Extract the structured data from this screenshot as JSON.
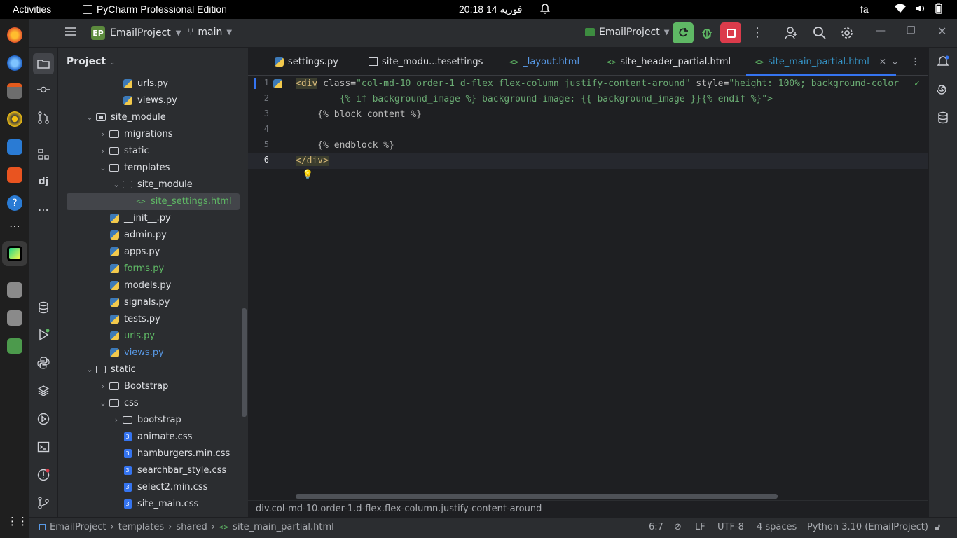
{
  "os_bar": {
    "activities": "Activities",
    "app_name": "PyCharm Professional Edition",
    "clock": "20:18  فوریه 14",
    "lang": "fa"
  },
  "toolbar": {
    "project_badge": "EP",
    "project_name": "EmailProject",
    "branch": "main",
    "run_config": "EmailProject"
  },
  "project_panel": {
    "title": "Project"
  },
  "tree": [
    {
      "label": "urls.py",
      "indent": 4,
      "type": "py",
      "chev": "",
      "color": "#dfe1e5"
    },
    {
      "label": "views.py",
      "indent": 4,
      "type": "py",
      "chev": "",
      "color": "#dfe1e5"
    },
    {
      "label": "site_module",
      "indent": 2,
      "type": "module",
      "chev": "⌄",
      "color": "#dfe1e5"
    },
    {
      "label": "migrations",
      "indent": 3,
      "type": "folder",
      "chev": "›",
      "color": "#dfe1e5"
    },
    {
      "label": "static",
      "indent": 3,
      "type": "folder",
      "chev": "›",
      "color": "#dfe1e5"
    },
    {
      "label": "templates",
      "indent": 3,
      "type": "folder",
      "chev": "⌄",
      "color": "#dfe1e5"
    },
    {
      "label": "site_module",
      "indent": 4,
      "type": "folder",
      "chev": "⌄",
      "color": "#dfe1e5"
    },
    {
      "label": "site_settings.html",
      "indent": 5,
      "type": "html",
      "chev": "",
      "color": "#5fb865"
    },
    {
      "label": "__init__.py",
      "indent": 3,
      "type": "py",
      "chev": "",
      "color": "#dfe1e5"
    },
    {
      "label": "admin.py",
      "indent": 3,
      "type": "py",
      "chev": "",
      "color": "#dfe1e5"
    },
    {
      "label": "apps.py",
      "indent": 3,
      "type": "py",
      "chev": "",
      "color": "#dfe1e5"
    },
    {
      "label": "forms.py",
      "indent": 3,
      "type": "py",
      "chev": "",
      "color": "#5fb865"
    },
    {
      "label": "models.py",
      "indent": 3,
      "type": "py",
      "chev": "",
      "color": "#dfe1e5"
    },
    {
      "label": "signals.py",
      "indent": 3,
      "type": "py",
      "chev": "",
      "color": "#dfe1e5"
    },
    {
      "label": "tests.py",
      "indent": 3,
      "type": "py",
      "chev": "",
      "color": "#dfe1e5"
    },
    {
      "label": "urls.py",
      "indent": 3,
      "type": "py",
      "chev": "",
      "color": "#5fb865"
    },
    {
      "label": "views.py",
      "indent": 3,
      "type": "py",
      "chev": "",
      "color": "#5899e6"
    },
    {
      "label": "static",
      "indent": 2,
      "type": "folder",
      "chev": "⌄",
      "color": "#dfe1e5"
    },
    {
      "label": "Bootstrap",
      "indent": 3,
      "type": "folder",
      "chev": "›",
      "color": "#dfe1e5"
    },
    {
      "label": "css",
      "indent": 3,
      "type": "folder",
      "chev": "⌄",
      "color": "#dfe1e5"
    },
    {
      "label": "bootstrap",
      "indent": 4,
      "type": "folder",
      "chev": "›",
      "color": "#dfe1e5"
    },
    {
      "label": "animate.css",
      "indent": 4,
      "type": "css",
      "chev": "",
      "color": "#dfe1e5"
    },
    {
      "label": "hamburgers.min.css",
      "indent": 4,
      "type": "css",
      "chev": "",
      "color": "#dfe1e5"
    },
    {
      "label": "searchbar_style.css",
      "indent": 4,
      "type": "css",
      "chev": "",
      "color": "#dfe1e5"
    },
    {
      "label": "select2.min.css",
      "indent": 4,
      "type": "css",
      "chev": "",
      "color": "#dfe1e5"
    },
    {
      "label": "site_main.css",
      "indent": 4,
      "type": "css",
      "chev": "",
      "color": "#dfe1e5"
    }
  ],
  "tabs": [
    {
      "label": "settings.py",
      "icon": "py"
    },
    {
      "label": "site_modu...tesettings",
      "icon": "table"
    },
    {
      "label": "_layout.html",
      "icon": "html"
    },
    {
      "label": "site_header_partial.html",
      "icon": "html"
    },
    {
      "label": "site_main_partial.html",
      "icon": "html"
    }
  ],
  "code_lines": [
    "1",
    "2",
    "3",
    "4",
    "5",
    "6"
  ],
  "code": {
    "l1_tag": "<div",
    "l1_attr1": " class=",
    "l1_str1": "\"col-md-10 order-1 d-flex flex-column justify-content-around\"",
    "l1_attr2": " style=",
    "l1_str2": "\"height: 100%; background-color",
    "l2_a": "        {% if background_image %}",
    "l2_b": " background-image: {{ background_image }}",
    "l2_c": "{% endif %}",
    "l2_d": "\">",
    "l3": "    {% block content %}",
    "l5": "    {% endblock %}",
    "l6": "</div>"
  },
  "breadcrumb": "div.col-md-10.order-1.d-flex.flex-column.justify-content-around",
  "statusbar": {
    "path": [
      "EmailProject",
      "templates",
      "shared",
      "site_main_partial.html"
    ],
    "position": "6:7",
    "line_sep": "LF",
    "encoding": "UTF-8",
    "indent": "4 spaces",
    "interpreter": "Python 3.10 (EmailProject)"
  }
}
